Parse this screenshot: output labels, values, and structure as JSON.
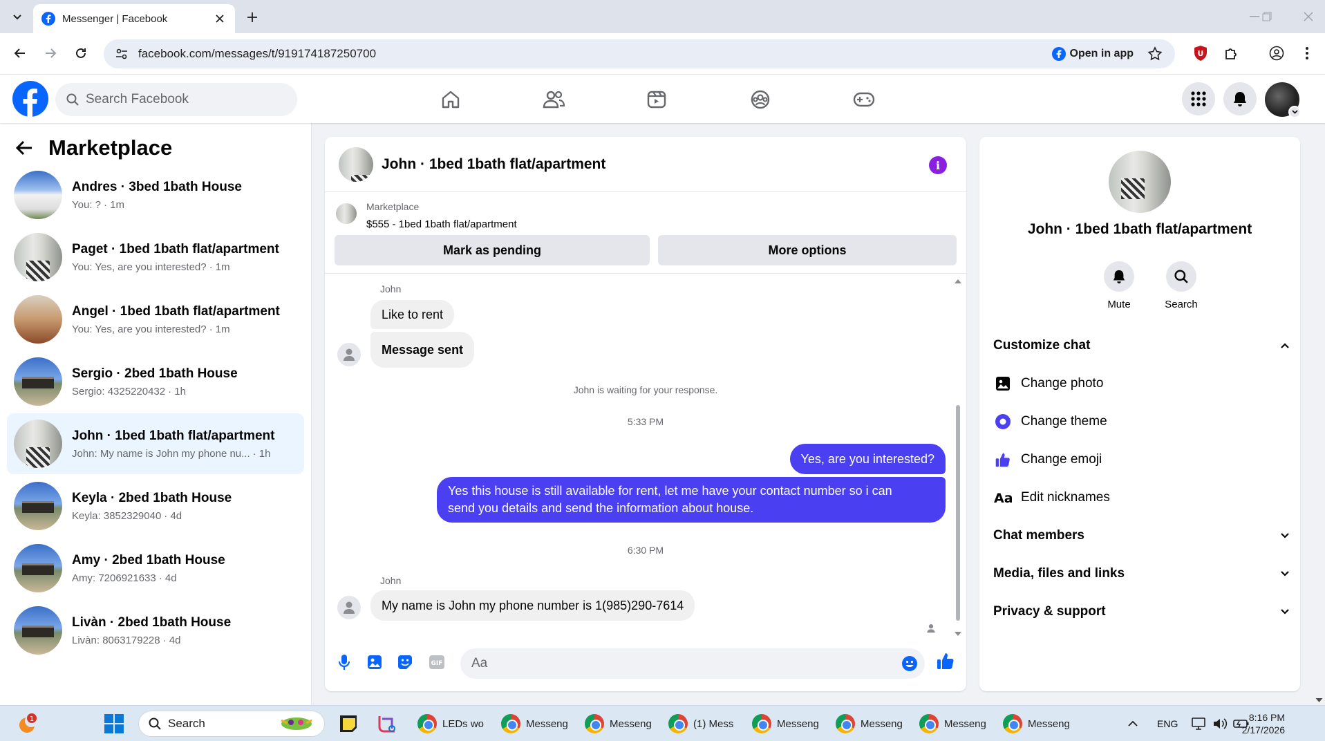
{
  "browser": {
    "tab_title": "Messenger | Facebook",
    "url": "facebook.com/messages/t/919174187250700",
    "open_in_app": "Open in app"
  },
  "fb_header": {
    "search_placeholder": "Search Facebook"
  },
  "left_panel": {
    "title": "Marketplace",
    "conversations": [
      {
        "name": "Andres · 3bed 1bath House",
        "preview": "You: ?",
        "time": "· 1m",
        "thumb": "white"
      },
      {
        "name": "Paget · 1bed 1bath flat/apartment",
        "preview": "You: Yes, are you interested?",
        "time": "· 1m",
        "thumb": "room"
      },
      {
        "name": "Angel · 1bed 1bath flat/apartment",
        "preview": "You: Yes, are you interested?",
        "time": "· 1m",
        "thumb": "wood"
      },
      {
        "name": "Sergio · 2bed 1bath House",
        "preview": "Sergio: 4325220432",
        "time": "· 1h",
        "thumb": "house"
      },
      {
        "name": "John · 1bed 1bath flat/apartment",
        "preview": "John: My name is John my phone nu...",
        "time": "· 1h",
        "thumb": "room",
        "active": true
      },
      {
        "name": "Keyla · 2bed 1bath House",
        "preview": "Keyla: 3852329040",
        "time": "· 4d",
        "thumb": "house"
      },
      {
        "name": "Amy · 2bed 1bath House",
        "preview": "Amy: 7206921633",
        "time": "· 4d",
        "thumb": "house"
      },
      {
        "name": "Livàn · 2bed 1bath House",
        "preview": "Livàn: 8063179228",
        "time": "· 4d",
        "thumb": "house"
      }
    ]
  },
  "chat": {
    "title": "John · 1bed 1bath flat/apartment",
    "marketplace_label": "Marketplace",
    "listing": "$555 - 1bed 1bath flat/apartment",
    "mark_pending": "Mark as pending",
    "more_options": "More options",
    "sender1": "John",
    "msg1": "Like to rent",
    "msg2": "Message sent",
    "waiting": "John is waiting for your response.",
    "time1": "5:33 PM",
    "out1": "Yes, are you interested?",
    "out2_line1": "Yes this house is still available for rent, let me have your contact number so i can",
    "out2_line2": "send you details and send the information about house.",
    "time2": "6:30 PM",
    "sender2": "John",
    "msg3": "My name is John my phone number is 1(985)290-7614",
    "composer_placeholder": "Aa",
    "gif_label": "GIF",
    "accent": "#4b3ff2"
  },
  "info_panel": {
    "name": "John · 1bed 1bath flat/apartment",
    "mute": "Mute",
    "search": "Search",
    "customize": "Customize chat",
    "change_photo": "Change photo",
    "change_theme": "Change theme",
    "change_emoji": "Change emoji",
    "edit_nicknames": "Edit nicknames",
    "chat_members": "Chat members",
    "media": "Media, files and links",
    "privacy": "Privacy & support"
  },
  "taskbar": {
    "search_placeholder": "Search",
    "notification_count": "1",
    "apps": [
      "LEDs wo",
      "Messeng",
      "Messeng",
      "(1) Mess",
      "Messeng",
      "Messeng",
      "Messeng",
      "Messeng"
    ],
    "lang": "ENG",
    "time": "8:16 PM",
    "date": "2/17/2026"
  }
}
